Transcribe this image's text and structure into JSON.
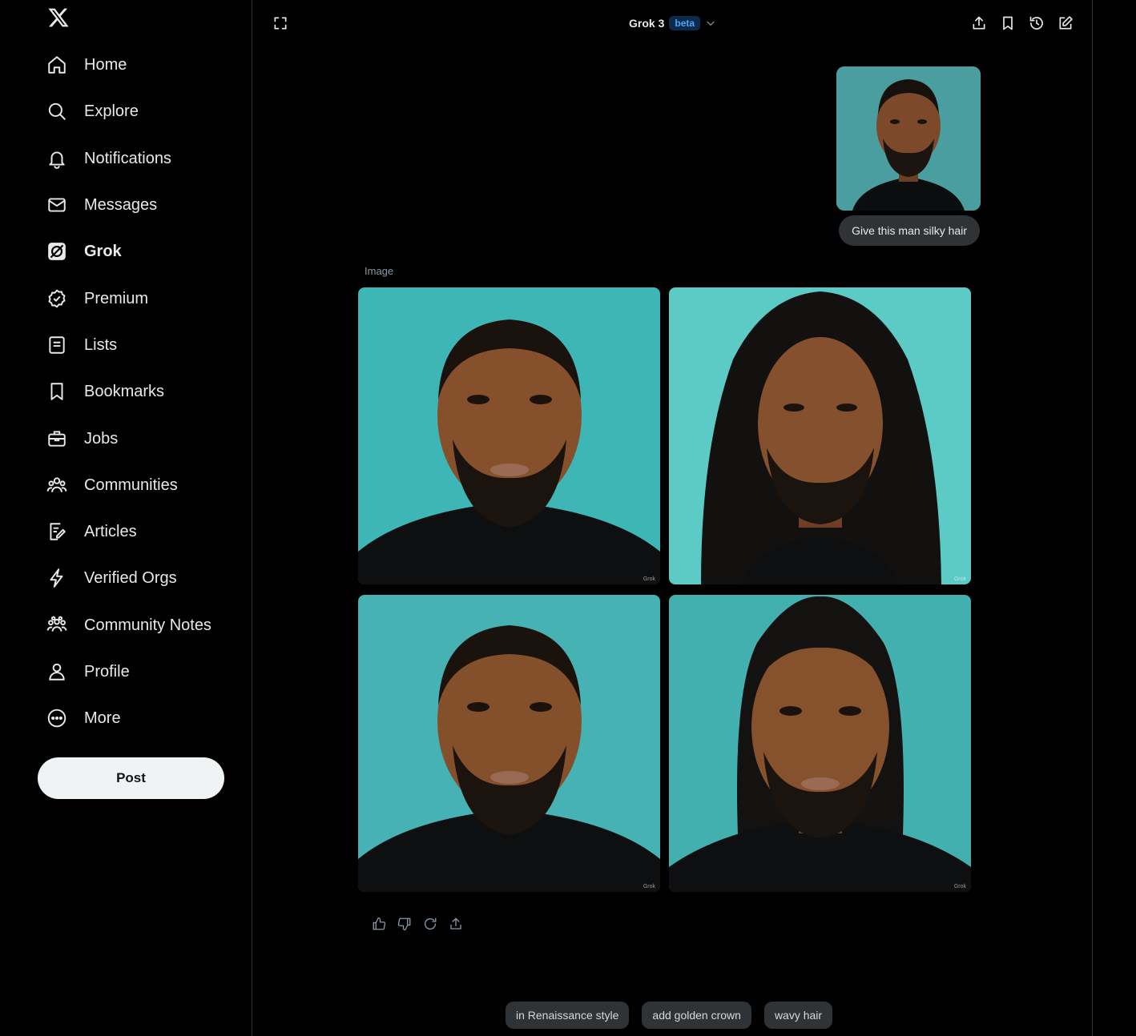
{
  "sidebar": {
    "items": [
      {
        "label": "Home",
        "icon": "home-icon"
      },
      {
        "label": "Explore",
        "icon": "search-icon"
      },
      {
        "label": "Notifications",
        "icon": "bell-icon"
      },
      {
        "label": "Messages",
        "icon": "envelope-icon"
      },
      {
        "label": "Grok",
        "icon": "grok-icon",
        "active": true
      },
      {
        "label": "Premium",
        "icon": "verified-badge-icon"
      },
      {
        "label": "Lists",
        "icon": "list-icon"
      },
      {
        "label": "Bookmarks",
        "icon": "bookmark-icon"
      },
      {
        "label": "Jobs",
        "icon": "briefcase-icon"
      },
      {
        "label": "Communities",
        "icon": "people-icon"
      },
      {
        "label": "Articles",
        "icon": "article-edit-icon"
      },
      {
        "label": "Verified Orgs",
        "icon": "lightning-icon"
      },
      {
        "label": "Community Notes",
        "icon": "community-notes-icon"
      },
      {
        "label": "Profile",
        "icon": "person-icon"
      },
      {
        "label": "More",
        "icon": "more-circle-icon"
      }
    ],
    "post_label": "Post"
  },
  "header": {
    "model_name": "Grok 3",
    "badge": "beta"
  },
  "conversation": {
    "user_prompt": "Give this man silky hair",
    "result_label": "Image",
    "watermark": "Grok"
  },
  "suggestions": [
    "in Renaissance style",
    "add golden crown",
    "wavy hair"
  ],
  "colors": {
    "background": "#000000",
    "teal": "#4fb8b6",
    "badge_text": "#4aa3ff"
  }
}
